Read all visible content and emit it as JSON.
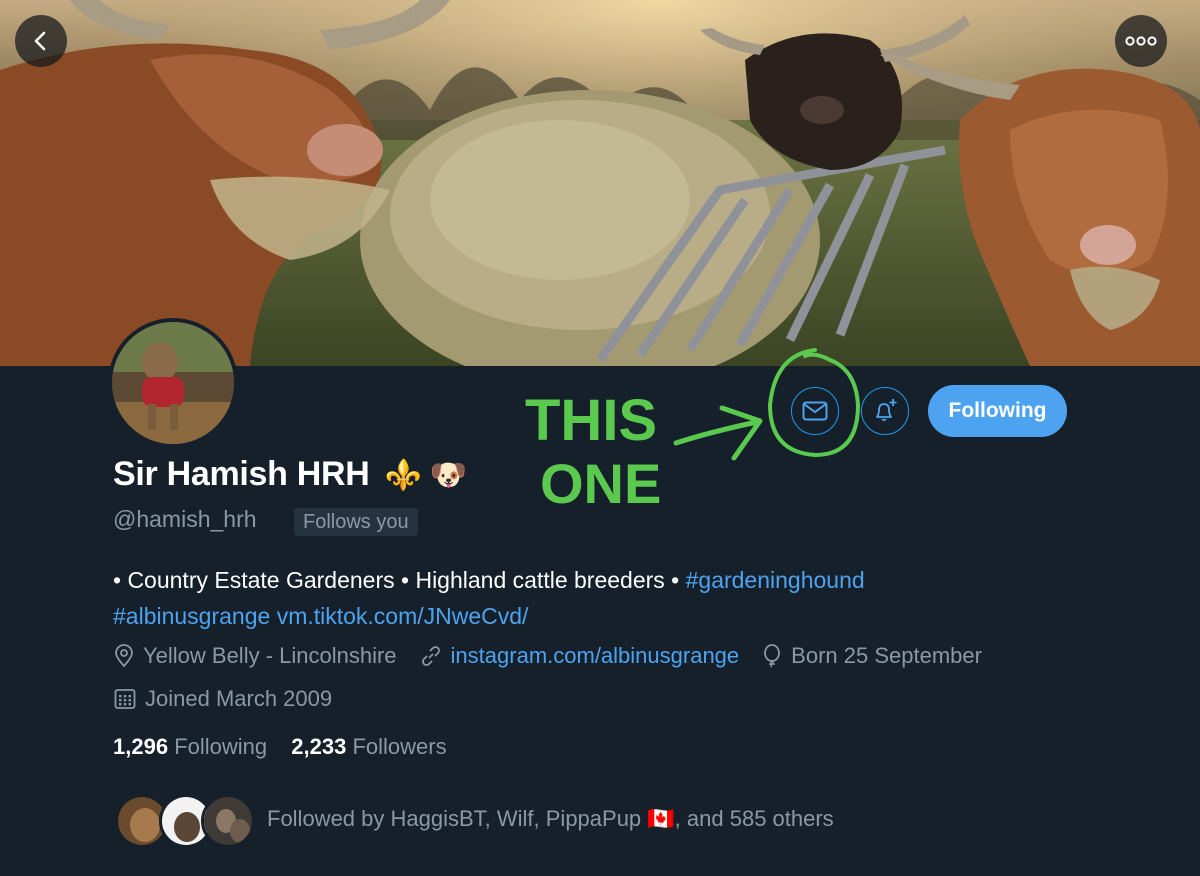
{
  "header": {
    "back_icon": "chevron-left-icon",
    "more_icon": "more-horizontal-icon"
  },
  "profile": {
    "name": "Sir Hamish HRH",
    "name_emoji": "⚜️ 🐶",
    "handle": "@hamish_hrh",
    "follows_you": "Follows you",
    "bio_line1_plain": "• Country Estate Gardeners • Highland cattle breeders • ",
    "bio_line1_hashtag": "#gardeninghound",
    "bio_line2_hashtag": "#albinusgrange",
    "bio_line2_link": "vm.tiktok.com/JNweCvd/",
    "location": "Yellow Belly - Lincolnshire",
    "website": "instagram.com/albinusgrange",
    "birthday": "Born 25 September",
    "joined": "Joined March 2009",
    "following_count": "1,296",
    "following_label": "Following",
    "followers_count": "2,233",
    "followers_label": "Followers",
    "followed_by": "Followed by HaggisBT, Wilf, PippaPup 🇨🇦, and 585 others"
  },
  "actions": {
    "message_icon": "envelope-icon",
    "notify_icon": "bell-plus-icon",
    "follow_label": "Following"
  },
  "annotation": {
    "line1": "THIS",
    "line2": "ONE",
    "color": "#5ac94e"
  },
  "colors": {
    "background": "#15202b",
    "accent": "#4da3f0",
    "secondary_text": "#8b98a5"
  }
}
